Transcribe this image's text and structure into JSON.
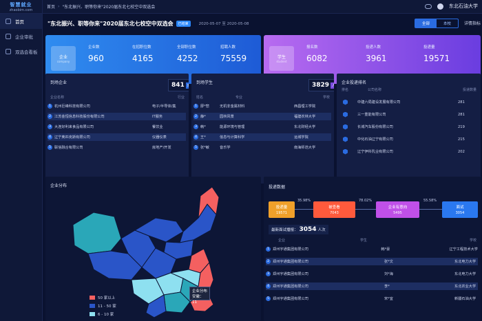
{
  "logo": {
    "line1": "智慧就业",
    "line2": "zhaobim.com"
  },
  "sidebar": {
    "items": [
      {
        "label": "首页",
        "active": true
      },
      {
        "label": "企业审批",
        "active": false
      },
      {
        "label": "双选会看板",
        "active": false
      }
    ]
  },
  "breadcrumb": {
    "home": "首页",
    "current": "\"东北振兴、职等你来\"2020届东北七校空中双选会"
  },
  "user": {
    "name": "东北石油大学"
  },
  "header": {
    "title": "\"东北振兴、职等你来\"2020届东北七校空中双选会",
    "badge": "已结束",
    "date": "2020-05-07 至 2020-05-08",
    "tabs": [
      "全部",
      "本校"
    ],
    "active_tab": "全部",
    "detail": "详情指标"
  },
  "kpi_company": {
    "icon_label": "企业",
    "icon_sub": "company",
    "items": [
      {
        "label": "企业数",
        "value": "960"
      },
      {
        "label": "在招职位数",
        "value": "4165"
      },
      {
        "label": "全部职位数",
        "value": "4252"
      },
      {
        "label": "招聘人数",
        "value": "75559"
      }
    ]
  },
  "kpi_student": {
    "icon_label": "学生",
    "icon_sub": "student",
    "items": [
      {
        "label": "报名数",
        "value": "6082"
      },
      {
        "label": "投递人数",
        "value": "3961"
      },
      {
        "label": "投递量",
        "value": "19571"
      }
    ]
  },
  "company_panel": {
    "title": "到场企业",
    "count": "841",
    "unit": "家",
    "headers": [
      "企业名称",
      "行业"
    ],
    "rows": [
      {
        "n": "1",
        "name": "杭州巨峰科技有限公司",
        "ind": "电子/半导体/集"
      },
      {
        "n": "2",
        "name": "江苏金恒信息科技股份有限公司",
        "ind": "IT服务"
      },
      {
        "n": "3",
        "name": "大连好利来食品有限公司",
        "ind": "餐饮业"
      },
      {
        "n": "4",
        "name": "辽宁奥匹克斯有限公司",
        "ind": "仪器仪表"
      },
      {
        "n": "5",
        "name": "联信融合有限公司",
        "ind": "房地产/开发"
      }
    ]
  },
  "student_panel": {
    "title": "到场学生",
    "count": "3829",
    "unit": "人",
    "headers": [
      "姓名",
      "专业",
      "学校"
    ],
    "rows": [
      {
        "n": "1",
        "name": "廖*悲",
        "major": "无机非金属材料",
        "school": "西昌理工学院"
      },
      {
        "n": "2",
        "name": "静*",
        "major": "园林风景",
        "school": "福建农林大学"
      },
      {
        "n": "3",
        "name": "韩*",
        "major": "能源环境与管理",
        "school": "东北财经大学"
      },
      {
        "n": "4",
        "name": "王*",
        "major": "信息与计算科学",
        "school": "运城学院"
      },
      {
        "n": "5",
        "name": "张*敏",
        "major": "音乐学",
        "school": "南海师范大学"
      }
    ]
  },
  "rank_panel": {
    "title": "企业投递排名",
    "headers": [
      "排名",
      "公司名称",
      "投递数量"
    ],
    "rows": [
      {
        "name": "中建六局建设发展有限公司",
        "count": "281"
      },
      {
        "name": "三一重能有限公司",
        "count": "281"
      },
      {
        "name": "长城汽车股份有限公司",
        "count": "219"
      },
      {
        "name": "中化石油辽宁有限公司",
        "count": "215"
      },
      {
        "name": "辽宁伊科乳业有限公司",
        "count": "202"
      }
    ]
  },
  "map_panel": {
    "title": "企业分布",
    "legend": [
      "50 家以上",
      "11 - 50 家",
      "6 - 10 家"
    ],
    "tooltip": {
      "title": "企业分布",
      "value": "安徽：11"
    }
  },
  "delivery_panel": {
    "title": "投递数据",
    "funnel": [
      {
        "label": "投递量",
        "value": "19571",
        "color": "#f0a02a"
      },
      {
        "label": "被查看",
        "value": "7043",
        "color": "#ff5a3c"
      },
      {
        "label": "企业有意向",
        "value": "5495",
        "color": "#c050e8"
      },
      {
        "label": "面试",
        "value": "3054",
        "color": "#2a78f0"
      }
    ],
    "rates": [
      "35.98%",
      "78.02%",
      "55.58%"
    ],
    "latest_label": "最新面试播报：",
    "latest_count": "3054",
    "latest_unit": "人次",
    "headers": [
      "企业",
      "学生",
      "学校"
    ],
    "rows": [
      {
        "n": "1",
        "company": "郑州宇通集团有限公司",
        "student": "韩*豪",
        "school": "辽宁工程技术大学"
      },
      {
        "n": "2",
        "company": "郑州宇通集团有限公司",
        "student": "张*文",
        "school": "东北电力大学"
      },
      {
        "n": "3",
        "company": "郑州宇通集团有限公司",
        "student": "刘*海",
        "school": "东北电力大学"
      },
      {
        "n": "4",
        "company": "郑州宇通集团有限公司",
        "student": "李*",
        "school": "东北农业大学"
      },
      {
        "n": "5",
        "company": "郑州宇通集团有限公司",
        "student": "宋*宜",
        "school": "新疆石油大学"
      }
    ]
  }
}
